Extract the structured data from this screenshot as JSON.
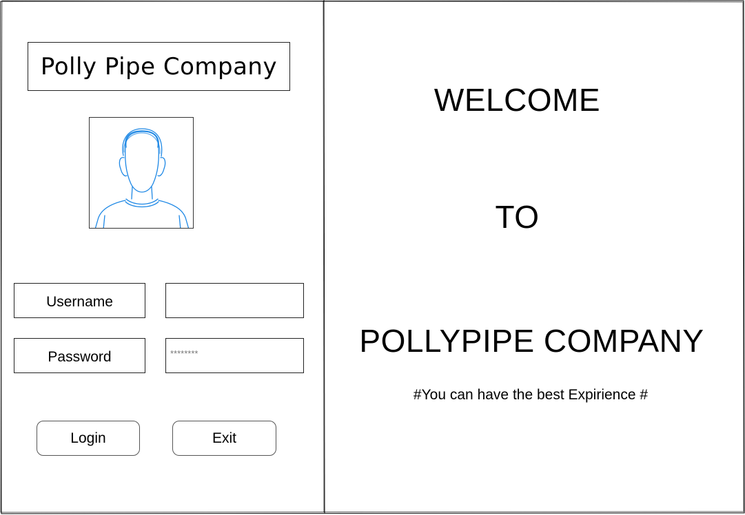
{
  "login_panel": {
    "title": "Polly Pipe Company",
    "avatar_icon": "user-avatar-icon",
    "username_label": "Username",
    "username_value": "",
    "password_label": "Password",
    "password_value": "********",
    "login_button": "Login",
    "exit_button": "Exit"
  },
  "welcome_panel": {
    "line1": "WELCOME",
    "line2": "TO",
    "line3": "POLLYPIPE COMPANY",
    "tagline": "#You can have the best Expirience #"
  },
  "colors": {
    "avatar_stroke": "#1e88e5",
    "border": "#222222",
    "background": "#ffffff"
  }
}
